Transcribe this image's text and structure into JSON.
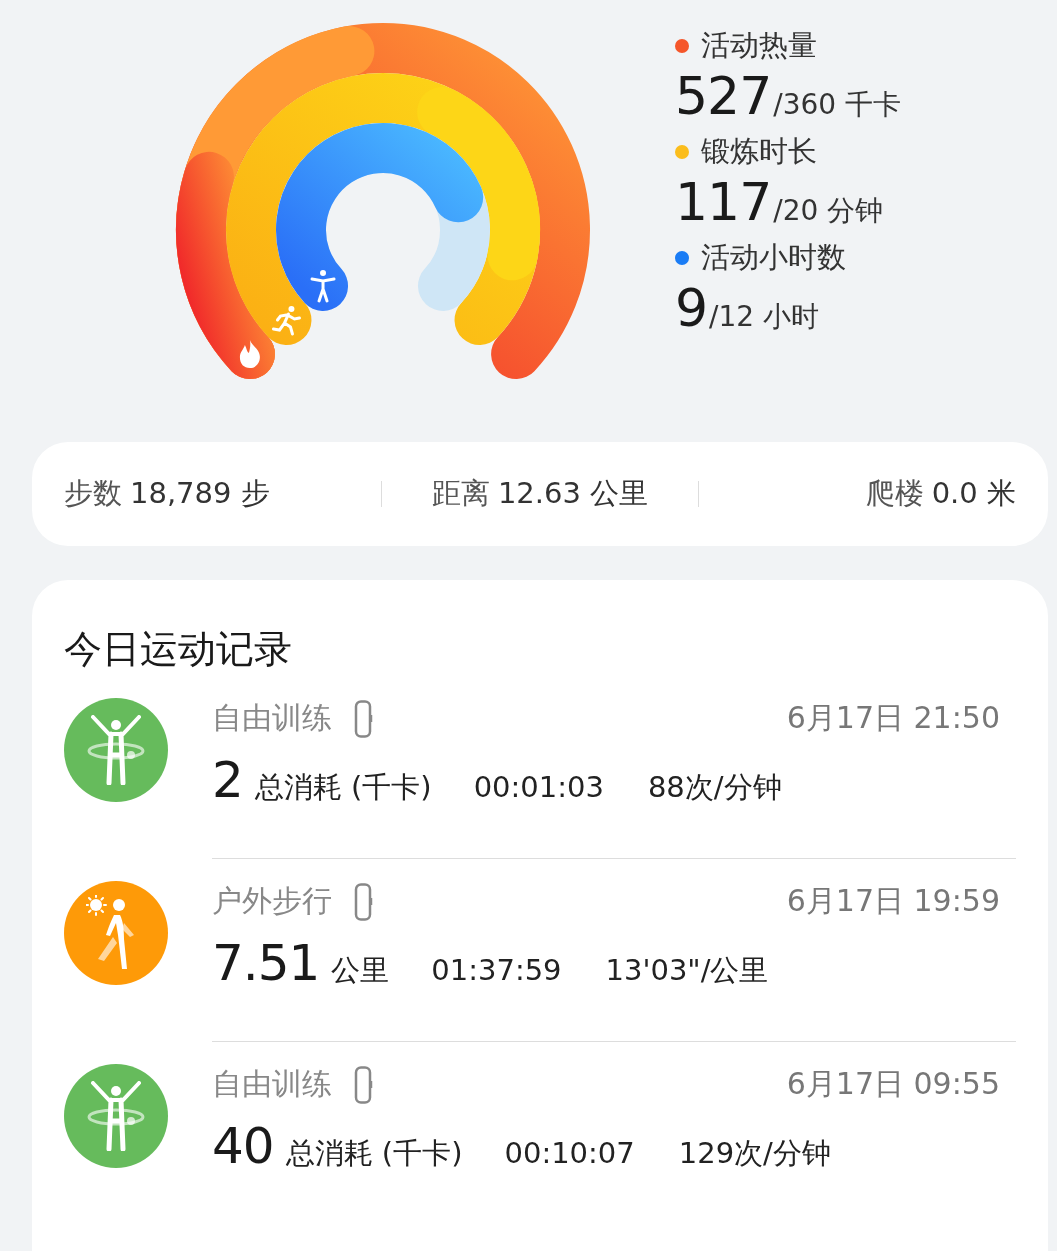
{
  "rings": [
    {
      "kind": "calories",
      "label": "活动热量",
      "value": "527",
      "goal": "/360 千卡",
      "color": "#f5562a"
    },
    {
      "kind": "exercise",
      "label": "锻炼时长",
      "value": "117",
      "goal": "/20 分钟",
      "color": "#fbbd1c"
    },
    {
      "kind": "active_hours",
      "label": "活动小时数",
      "value": "9",
      "goal": "/12 小时",
      "color": "#1a7cf5"
    }
  ],
  "stats": [
    {
      "label": "步数",
      "value": "18,789 步"
    },
    {
      "label": "距离",
      "value": "12.63 公里"
    },
    {
      "label": "爬楼",
      "value": "0.0 米"
    }
  ],
  "records": {
    "title": "今日运动记录",
    "items": [
      {
        "kind": "free_training",
        "color": "#66bb5c",
        "name": "自由训练",
        "time": "6月17日 21:50",
        "value": "2",
        "unit": "总消耗 (千卡)",
        "metrics": [
          "00:01:03",
          "88次/分钟"
        ]
      },
      {
        "kind": "outdoor_walk",
        "color": "#fe9a08",
        "name": "户外步行",
        "time": "6月17日 19:59",
        "value": "7.51",
        "unit": "公里",
        "metrics": [
          "01:37:59",
          "13'03\"/公里"
        ]
      },
      {
        "kind": "free_training",
        "color": "#66bb5c",
        "name": "自由训练",
        "time": "6月17日 09:55",
        "value": "40",
        "unit": "总消耗 (千卡)",
        "metrics": [
          "00:10:07",
          "129次/分钟"
        ]
      }
    ]
  }
}
